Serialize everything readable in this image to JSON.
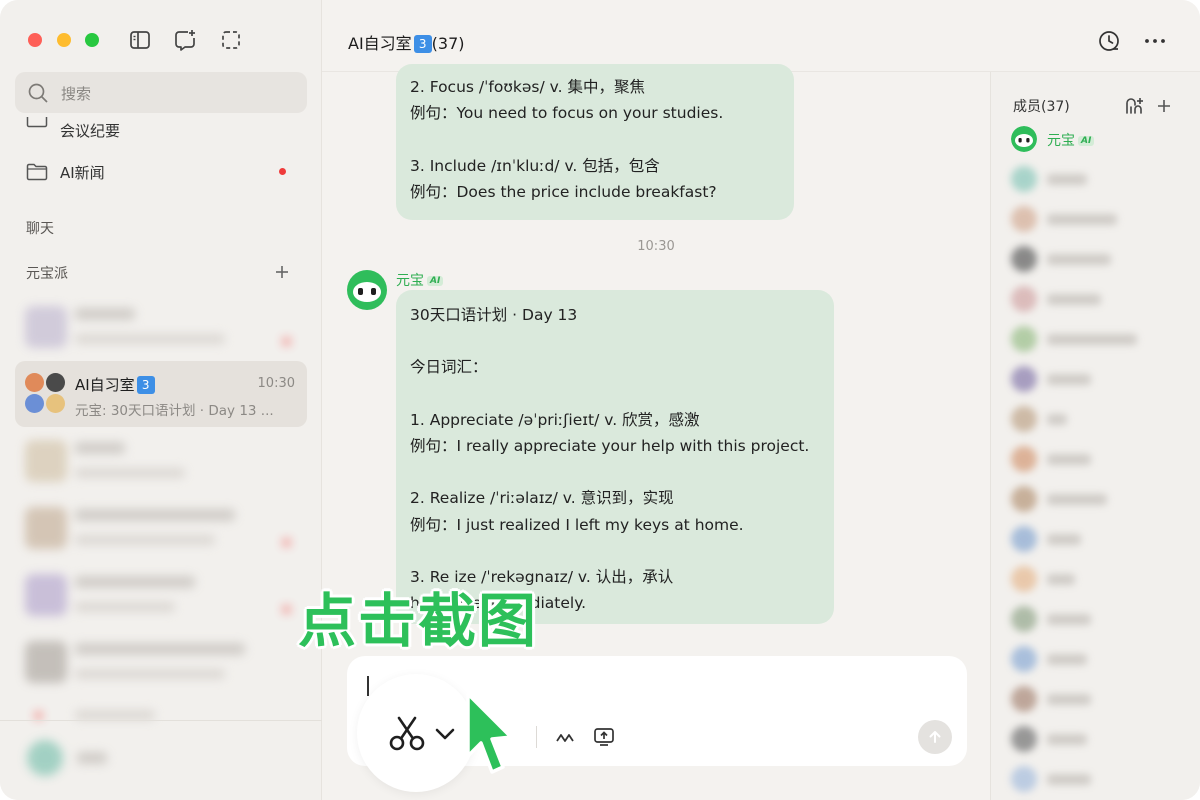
{
  "sidebar": {
    "search_placeholder": "搜索",
    "cut_item_label": "会议纪要",
    "ai_news_label": "AI新闻",
    "section_chat": "聊天",
    "section_yuanbaopai": "元宝派",
    "chats": [
      {
        "name": "",
        "time": "",
        "preview": "",
        "blurred": true
      },
      {
        "name": "AI自习室",
        "badge": "3",
        "time": "10:30",
        "preview": "元宝: 30天口语计划 · Day 13 ...",
        "blurred": false
      },
      {
        "name": "",
        "time": "",
        "preview": "",
        "blurred": true
      },
      {
        "name": "",
        "time": "",
        "preview": "",
        "blurred": true
      },
      {
        "name": "",
        "time": "",
        "preview": "",
        "blurred": true
      },
      {
        "name": "",
        "time": "",
        "preview": "",
        "blurred": true
      }
    ]
  },
  "header": {
    "title": "AI自习室",
    "badge": "3",
    "count": "(37)"
  },
  "messages": {
    "prev_bubble_lines": [
      "2. Focus /ˈfoʊkəs/ v. 集中，聚焦",
      "例句：You need to focus on your studies.",
      "",
      "3. Include /ɪnˈkluːd/ v. 包括，包含",
      "例句：Does the price include breakfast?"
    ],
    "timestamp": "10:30",
    "bot_name": "元宝",
    "ai_tag": "AI",
    "bubble_lines": [
      "30天口语计划 · Day 13",
      "",
      "今日词汇：",
      "",
      "1. Appreciate /əˈpriːʃieɪt/ v. 欣赏，感激",
      "例句：I really appreciate your help with this project.",
      "",
      "2. Realize /ˈriːəlaɪz/ v. 意识到，实现",
      "例句：I just realized I left my keys at home.",
      "",
      "3. Re   ize /ˈrekəgnaɪz/ v. 认出，承认",
      "                    her voice immediately."
    ]
  },
  "members": {
    "title": "成员(37)",
    "first": {
      "name": "元宝",
      "tag": "AI"
    },
    "colors": [
      "#9ccfc4",
      "#d9b8a5",
      "#777777",
      "#d8b3b3",
      "#a8c79a",
      "#9a8fb8",
      "#c7b19a",
      "#d9a88a",
      "#c0a58c",
      "#9ab4d6",
      "#e8c2a0",
      "#a3b39c",
      "#9db7d9",
      "#b59a8c",
      "#888888",
      "#b3c6e0",
      "#9fd1c4"
    ]
  },
  "overlay": {
    "caption": "点击截图"
  },
  "colors": {
    "accent_green": "#2dc05a",
    "bubble": "#dae9dc",
    "background": "#f4f2ef"
  }
}
